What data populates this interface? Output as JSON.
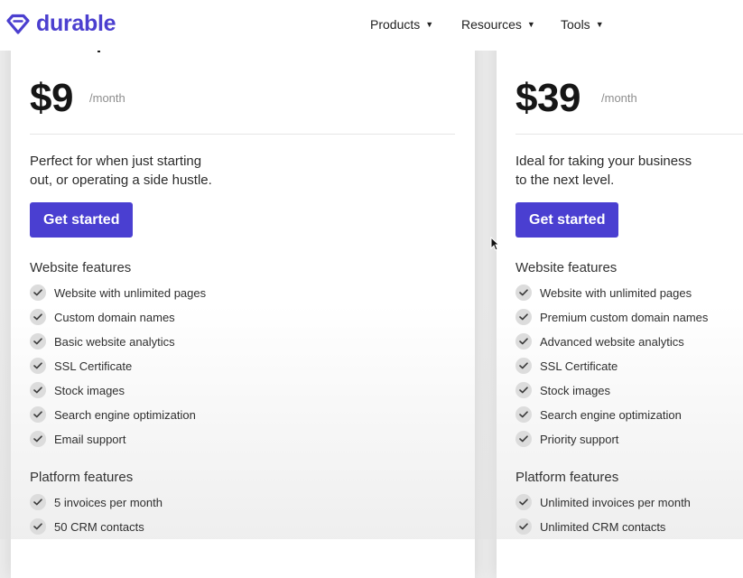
{
  "brand": {
    "name": "durable",
    "logo_color": "#4b3fcf"
  },
  "nav": [
    {
      "label": "Products",
      "icon": "caret-down-icon"
    },
    {
      "label": "Resources",
      "icon": "caret-down-icon"
    },
    {
      "label": "Tools",
      "icon": "caret-down-icon"
    }
  ],
  "accent": "#4a3fd1",
  "plans": [
    {
      "price": "$9",
      "period": "/month",
      "description": [
        "Perfect for when just starting",
        "out, or operating a side hustle."
      ],
      "cta": "Get started",
      "website_title": "Website features",
      "website_features": [
        "Website with unlimited pages",
        "Custom domain names",
        "Basic website analytics",
        "SSL Certificate",
        "Stock images",
        "Search engine optimization",
        "Email support"
      ],
      "platform_title": "Platform features",
      "platform_features": [
        "5 invoices per month",
        "50 CRM contacts"
      ]
    },
    {
      "price": "$39",
      "period": "/month",
      "description": [
        "Ideal for taking your business",
        "to the next level."
      ],
      "cta": "Get started",
      "website_title": "Website features",
      "website_features": [
        "Website with unlimited pages",
        "Premium custom domain names",
        "Advanced website analytics",
        "SSL Certificate",
        "Stock images",
        "Search engine optimization",
        "Priority support"
      ],
      "platform_title": "Platform features",
      "platform_features": [
        "Unlimited invoices per month",
        "Unlimited CRM contacts"
      ]
    }
  ]
}
